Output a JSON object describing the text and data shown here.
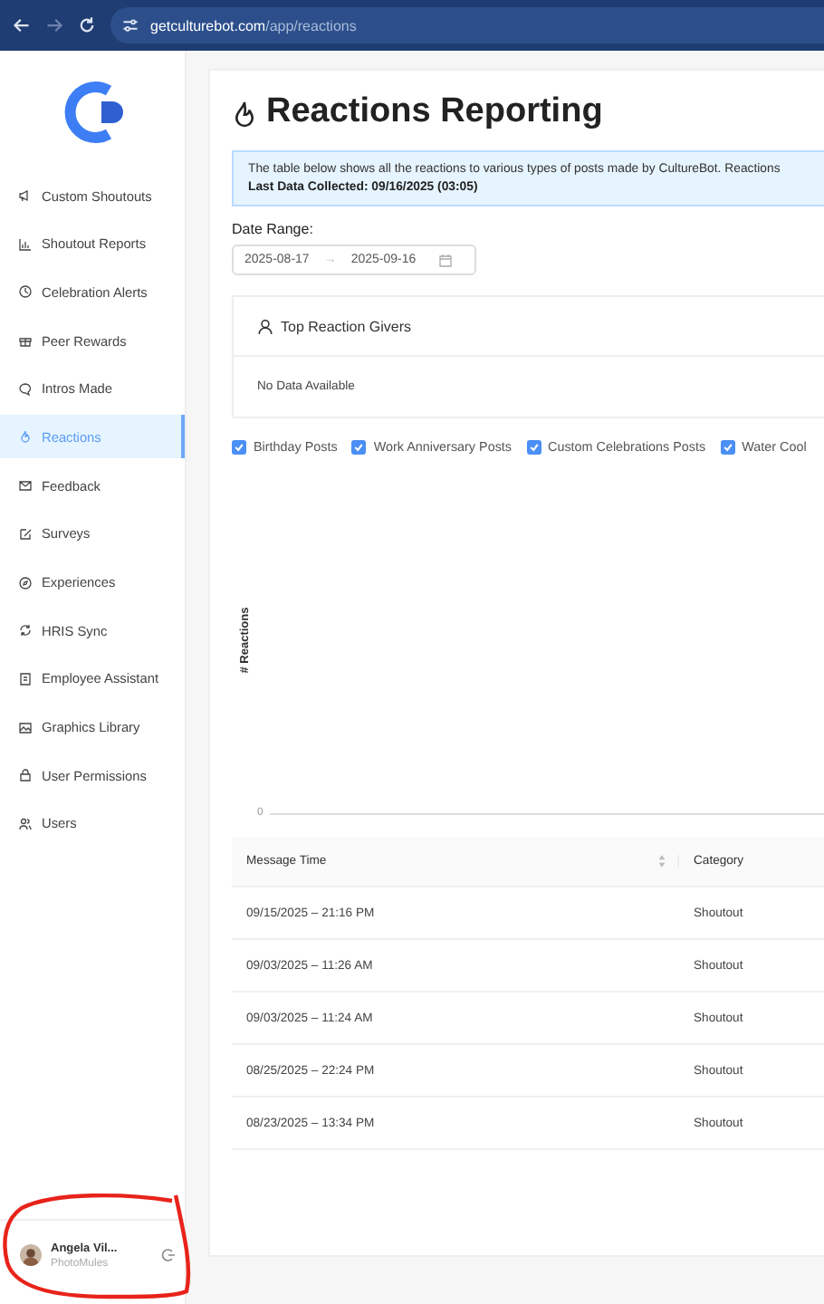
{
  "browser": {
    "url_host": "getculturebot.com",
    "url_path": "/app/reactions"
  },
  "sidebar": {
    "items": [
      {
        "label": "Custom Shoutouts",
        "selected": false
      },
      {
        "label": "Shoutout Reports",
        "selected": false
      },
      {
        "label": "Celebration Alerts",
        "selected": false
      },
      {
        "label": "Peer Rewards",
        "selected": false
      },
      {
        "label": "Intros Made",
        "selected": false
      },
      {
        "label": "Reactions",
        "selected": true
      },
      {
        "label": "Feedback",
        "selected": false
      },
      {
        "label": "Surveys",
        "selected": false
      },
      {
        "label": "Experiences",
        "selected": false
      },
      {
        "label": "HRIS Sync",
        "selected": false
      },
      {
        "label": "Employee Assistant",
        "selected": false
      },
      {
        "label": "Graphics Library",
        "selected": false
      },
      {
        "label": "User Permissions",
        "selected": false
      },
      {
        "label": "Users",
        "selected": false
      }
    ],
    "user": {
      "name": "Angela Vil...",
      "org": "PhotoMules"
    }
  },
  "page": {
    "title": "Reactions Reporting",
    "info": {
      "text": "The table below shows all the reactions to various types of posts made by CultureBot. Reactions",
      "last_collected": "Last Data Collected: 09/16/2025 (03:05)"
    },
    "date_range": {
      "label": "Date Range:",
      "start": "2025-08-17",
      "separator": "→",
      "end": "2025-09-16"
    },
    "top_givers": {
      "title": "Top Reaction Givers",
      "empty": "No Data Available"
    },
    "filters": [
      {
        "label": "Birthday Posts",
        "checked": true
      },
      {
        "label": "Work Anniversary Posts",
        "checked": true
      },
      {
        "label": "Custom Celebrations Posts",
        "checked": true
      },
      {
        "label": "Water Cool",
        "checked": true
      }
    ],
    "chart": {
      "ylabel": "# Reactions",
      "ytick": "0"
    },
    "table": {
      "columns": [
        "Message Time",
        "Category"
      ],
      "rows": [
        [
          "09/15/2025 – 21:16 PM",
          "Shoutout"
        ],
        [
          "09/03/2025 – 11:26 AM",
          "Shoutout"
        ],
        [
          "09/03/2025 – 11:24 AM",
          "Shoutout"
        ],
        [
          "08/25/2025 – 22:24 PM",
          "Shoutout"
        ],
        [
          "08/23/2025 – 13:34 PM",
          "Shoutout"
        ]
      ]
    }
  },
  "annotations": [
    {
      "kind": "freehand-circle",
      "color": "#e8231a"
    }
  ]
}
